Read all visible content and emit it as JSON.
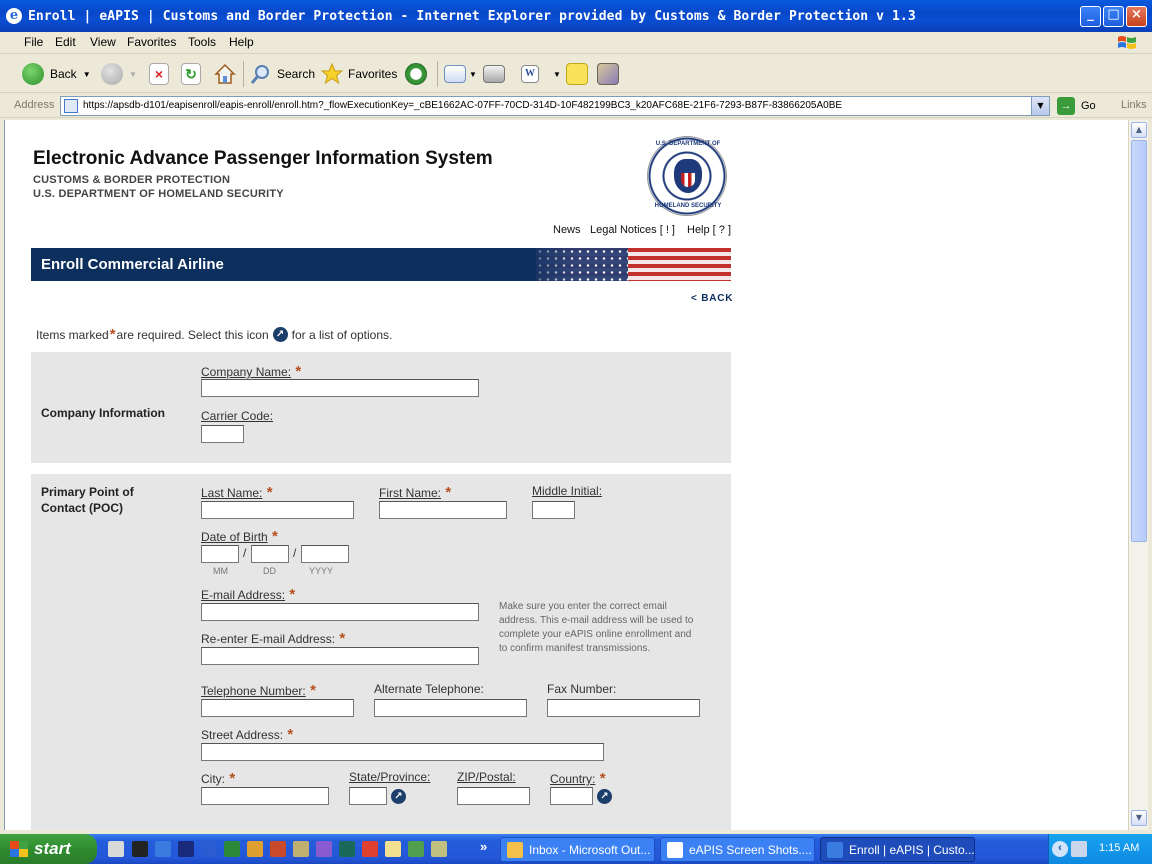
{
  "window": {
    "title": "Enroll | eAPIS | Customs and Border Protection - Internet Explorer provided by Customs & Border Protection v 1.3",
    "minimize": "_",
    "maximize": "□",
    "close": "×"
  },
  "menu": [
    "File",
    "Edit",
    "View",
    "Favorites",
    "Tools",
    "Help"
  ],
  "toolbar": {
    "back": "Back",
    "search": "Search",
    "favorites": "Favorites"
  },
  "address": {
    "label": "Address",
    "url": "https://apsdb-d101/eapisenroll/eapis-enroll/enroll.htm?_flowExecutionKey=_cBE1662AC-07FF-70CD-314D-10F482199BC3_k20AFC68E-21F6-7293-B87F-83866205A0BE",
    "go": "Go",
    "links": "Links"
  },
  "header": {
    "title": "Electronic Advance Passenger Information System",
    "sub1": "CUSTOMS & BORDER PROTECTION",
    "sub2": "U.S. DEPARTMENT OF HOMELAND SECURITY",
    "seal_top": "U.S. DEPARTMENT OF",
    "seal_bottom": "HOMELAND SECURITY"
  },
  "top_links": {
    "news": "News",
    "legal": "Legal Notices [ ! ]",
    "help": "Help [ ? ]"
  },
  "banner": {
    "title": "Enroll Commercial Airline"
  },
  "back_link": "< BACK",
  "note": {
    "before": "Items marked",
    "star": "*",
    "middle": "are required. Select this icon",
    "after": "for a list of options."
  },
  "company": {
    "section": "Company Information",
    "name_label": "Company Name:",
    "carrier_label": "Carrier Code:"
  },
  "poc": {
    "section": "Primary Point of Contact (POC)",
    "last_name": "Last Name:",
    "first_name": "First Name:",
    "middle_initial": "Middle Initial:",
    "dob": "Date of Birth",
    "mm": "MM",
    "dd": "DD",
    "yyyy": "YYYY",
    "slash": "/",
    "email": "E-mail Address:",
    "email_reenter": "Re-enter E-mail Address:",
    "email_note": "Make sure you enter the correct email address. This e-mail address will be used to complete your eAPIS online enrollment and to confirm manifest transmissions.",
    "phone": "Telephone Number:",
    "alt_phone": "Alternate Telephone:",
    "fax": "Fax Number:",
    "street": "Street Address:",
    "city": "City:",
    "state": "State/Province:",
    "zip": "ZIP/Postal:",
    "country": "Country:"
  },
  "taskbar": {
    "start": "start",
    "overflow": "»",
    "tasks": [
      {
        "label": "Inbox - Microsoft Out..."
      },
      {
        "label": "eAPIS Screen Shots...."
      },
      {
        "label": "Enroll | eAPIS | Custo..."
      }
    ],
    "clock": "1:15 AM"
  },
  "colors": {
    "banner": "#0d2f5d",
    "required": "#b5501d",
    "panel": "#e6e6e6",
    "help": "#a01515"
  }
}
